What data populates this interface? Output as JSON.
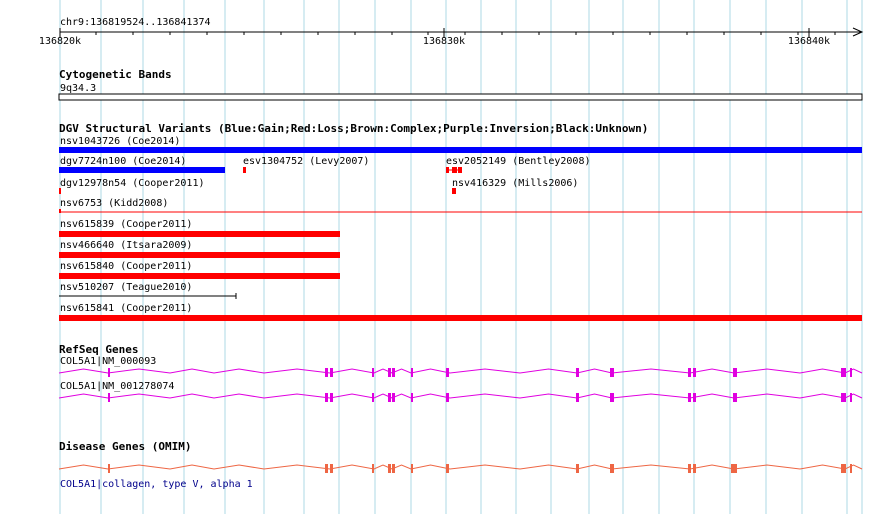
{
  "colors": {
    "grid": "#add8e6",
    "gain": "#0000ff",
    "loss": "#ff0000",
    "neutral": "#000000",
    "refseq": "#e000e0",
    "omim": "#ee6644",
    "omim_label": "#00008b"
  },
  "ruler": {
    "location": "chr9:136819524..136841374",
    "ticks": [
      {
        "label": "136820k",
        "pos": 136820000
      },
      {
        "label": "136830k",
        "pos": 136830000
      },
      {
        "label": "136840k",
        "pos": 136840000
      }
    ]
  },
  "cytoband": {
    "title": "Cytogenetic Bands",
    "band": "9q34.3"
  },
  "dgv": {
    "title": "DGV Structural Variants (Blue:Gain;Red:Loss;Brown:Complex;Purple:Inversion;Black:Unknown)",
    "variants": [
      {
        "label": "nsv1043726 (Coe2014)",
        "type": "gain"
      },
      {
        "label": "dgv7724n100 (Coe2014)",
        "type": "gain"
      },
      {
        "label": "esv1304752 (Levy2007)",
        "type": "loss"
      },
      {
        "label": "esv2052149 (Bentley2008)",
        "type": "loss"
      },
      {
        "label": "dgv12978n54 (Cooper2011)",
        "type": "loss"
      },
      {
        "label": "nsv416329 (Mills2006)",
        "type": "loss"
      },
      {
        "label": "nsv6753 (Kidd2008)",
        "type": "loss"
      },
      {
        "label": "nsv615839 (Cooper2011)",
        "type": "loss"
      },
      {
        "label": "nsv466640 (Itsara2009)",
        "type": "loss"
      },
      {
        "label": "nsv615840 (Cooper2011)",
        "type": "loss"
      },
      {
        "label": "nsv510207 (Teague2010)",
        "type": "unknown"
      },
      {
        "label": "nsv615841 (Cooper2011)",
        "type": "loss"
      }
    ]
  },
  "refseq": {
    "title": "RefSeq Genes",
    "transcripts": [
      {
        "label": "COL5A1|NM_000093"
      },
      {
        "label": "COL5A1|NM_001278074"
      }
    ]
  },
  "omim": {
    "title": "Disease Genes (OMIM)",
    "genes": [
      {
        "label": "COL5A1|collagen, type V, alpha 1"
      }
    ]
  }
}
